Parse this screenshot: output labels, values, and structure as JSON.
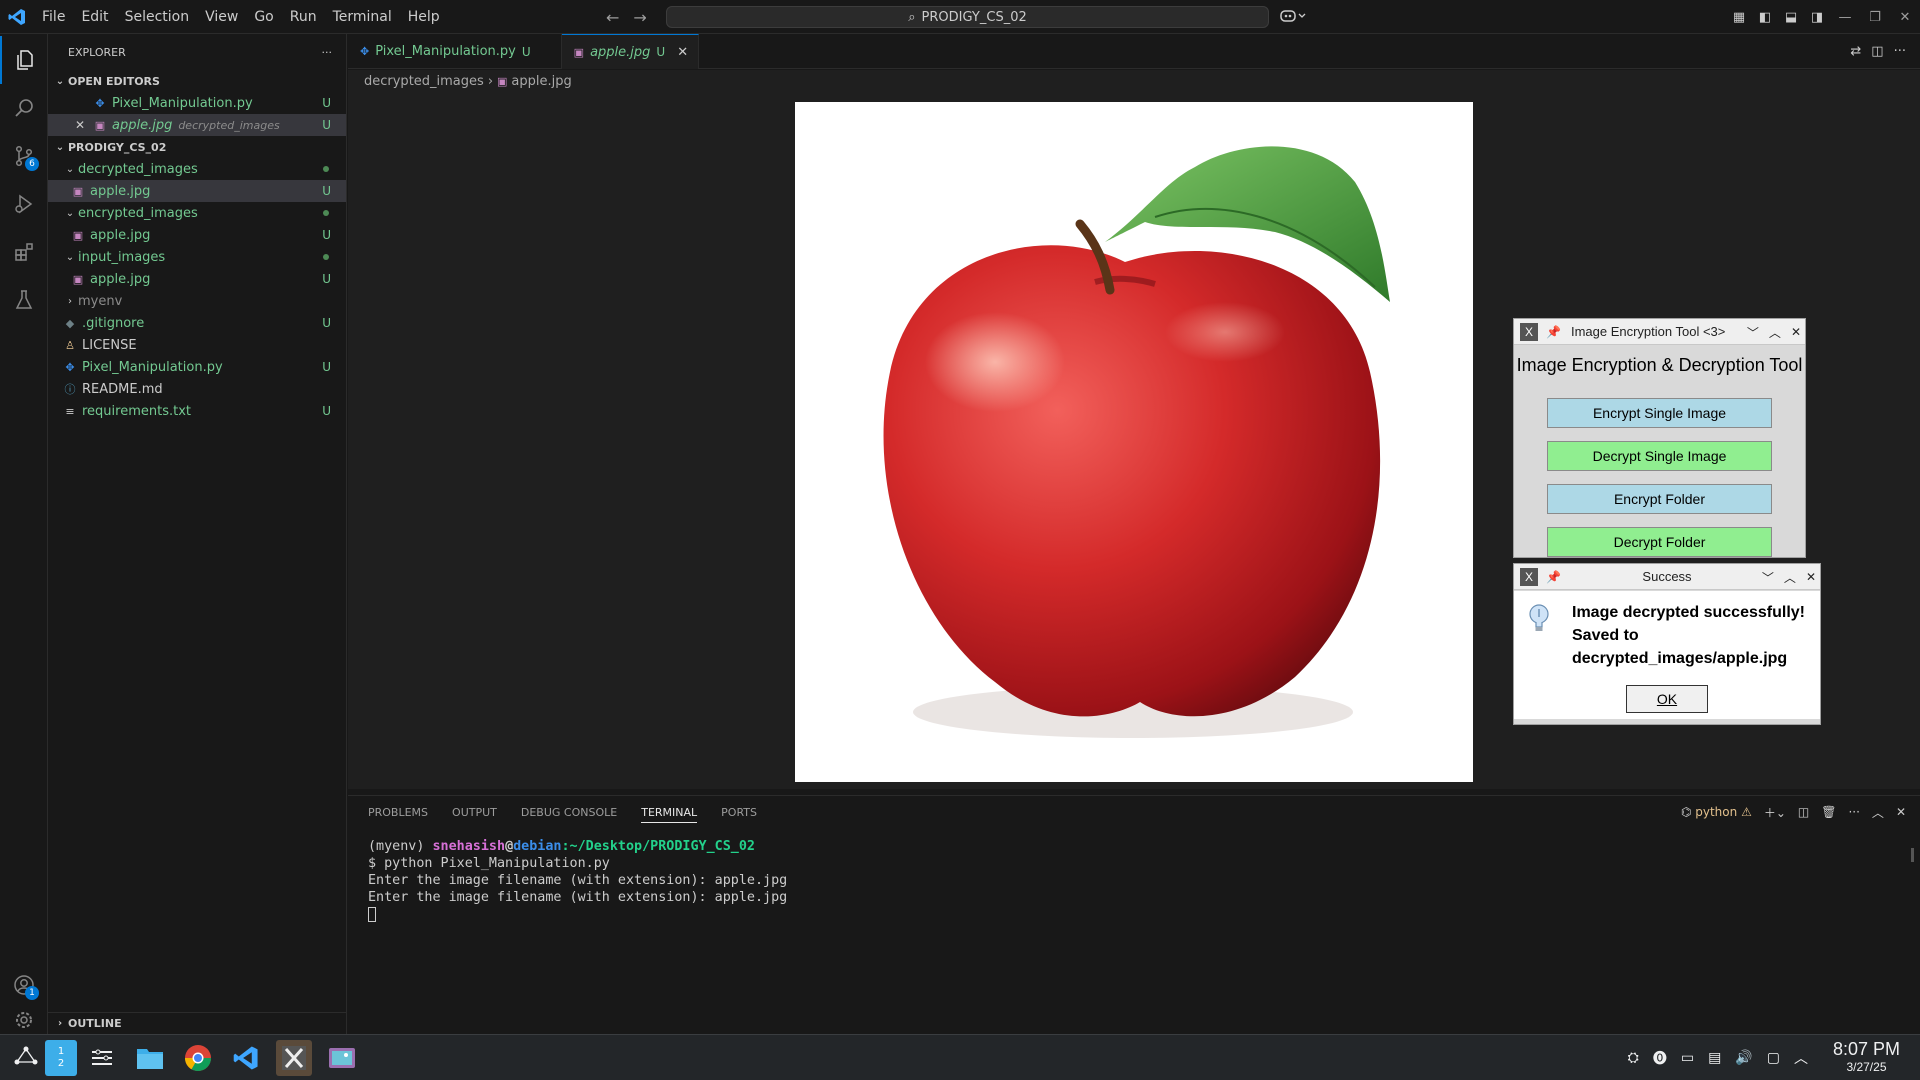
{
  "menu": [
    "File",
    "Edit",
    "Selection",
    "View",
    "Go",
    "Run",
    "Terminal",
    "Help"
  ],
  "command_center": {
    "label": "PRODIGY_CS_02"
  },
  "sidebar": {
    "title": "EXPLORER",
    "open_editors_label": "OPEN EDITORS",
    "open_editors": [
      {
        "name": "Pixel_Manipulation.py",
        "status": "U"
      },
      {
        "name": "apple.jpg",
        "hint": "decrypted_images",
        "status": "U"
      }
    ],
    "workspace_label": "PRODIGY_CS_02",
    "tree": [
      {
        "name": "decrypted_images",
        "type": "folder"
      },
      {
        "name": "apple.jpg",
        "type": "file",
        "status": "U"
      },
      {
        "name": "encrypted_images",
        "type": "folder"
      },
      {
        "name": "apple.jpg",
        "type": "file",
        "status": "U"
      },
      {
        "name": "input_images",
        "type": "folder"
      },
      {
        "name": "apple.jpg",
        "type": "file",
        "status": "U"
      },
      {
        "name": "myenv",
        "type": "folder"
      },
      {
        "name": ".gitignore",
        "type": "file",
        "status": "U"
      },
      {
        "name": "LICENSE",
        "type": "file"
      },
      {
        "name": "Pixel_Manipulation.py",
        "type": "file",
        "status": "U"
      },
      {
        "name": "README.md",
        "type": "file"
      },
      {
        "name": "requirements.txt",
        "type": "file",
        "status": "U"
      }
    ],
    "outline_label": "OUTLINE"
  },
  "activity": {
    "scm_badge": "6",
    "accounts_badge": "1"
  },
  "tabs": [
    {
      "label": "Pixel_Manipulation.py",
      "status": "U"
    },
    {
      "label": "apple.jpg",
      "status": "U"
    }
  ],
  "breadcrumb": [
    "decrypted_images",
    "apple.jpg"
  ],
  "panel": {
    "tabs": [
      "PROBLEMS",
      "OUTPUT",
      "DEBUG CONSOLE",
      "TERMINAL",
      "PORTS"
    ],
    "terminal_name": "python",
    "prompt": {
      "env": "(myenv) ",
      "user": "snehasish",
      "at": "@",
      "host": "debian",
      "path": ":~/Desktop/PRODIGY_CS_02"
    },
    "command": "$ python Pixel_Manipulation.py",
    "output": [
      "Enter the image filename (with extension): apple.jpg",
      "Enter the image filename (with extension): apple.jpg"
    ]
  },
  "tool_window": {
    "title": "Image Encryption Tool <3>",
    "heading": "Image Encryption & Decryption Tool",
    "buttons": [
      "Encrypt Single Image",
      "Decrypt Single Image",
      "Encrypt Folder",
      "Decrypt Folder"
    ]
  },
  "success_dialog": {
    "title": "Success",
    "line1": "Image decrypted successfully!",
    "line2": "Saved to",
    "line3": "decrypted_images/apple.jpg",
    "ok": "OK"
  },
  "taskbar": {
    "pager": [
      "1",
      "2"
    ],
    "time": "8:07 PM",
    "date": "3/27/25"
  },
  "colors": {
    "accent": "#0078d4",
    "untracked": "#73c991",
    "encrypt_btn": "#add8e6",
    "decrypt_btn": "#90ee90"
  }
}
